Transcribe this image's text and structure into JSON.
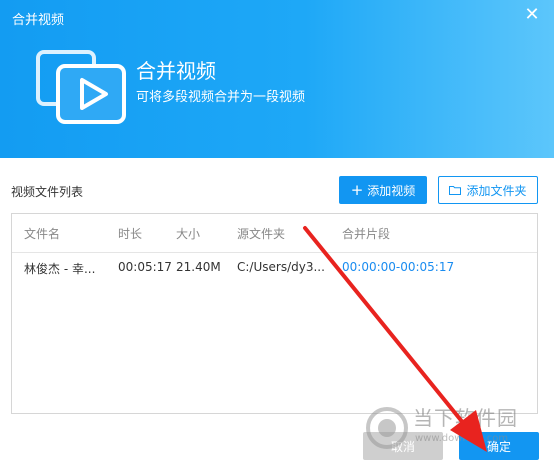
{
  "window": {
    "title": "合并视频",
    "close_icon": "close-icon"
  },
  "hero": {
    "title": "合并视频",
    "subtitle": "可将多段视频合并为一段视频",
    "icon": "video-stack-icon"
  },
  "toolbar": {
    "section_label": "视频文件列表",
    "add_video_label": "添加视频",
    "add_folder_label": "添加文件夹"
  },
  "table": {
    "columns": [
      "文件名",
      "时长",
      "大小",
      "源文件夹",
      "合并片段"
    ],
    "rows": [
      {
        "name": "林俊杰 - 幸...",
        "duration": "00:05:17",
        "size": "21.40M",
        "folder": "C:/Users/dy3...",
        "segment": "00:00:00-00:05:17"
      }
    ]
  },
  "footer": {
    "cancel_label": "取消",
    "ok_label": "确定"
  },
  "watermark": {
    "text": "当下软件园",
    "url": "www.downxia.com"
  },
  "colors": {
    "accent": "#1296f2",
    "annotation_arrow": "#e8231f"
  }
}
